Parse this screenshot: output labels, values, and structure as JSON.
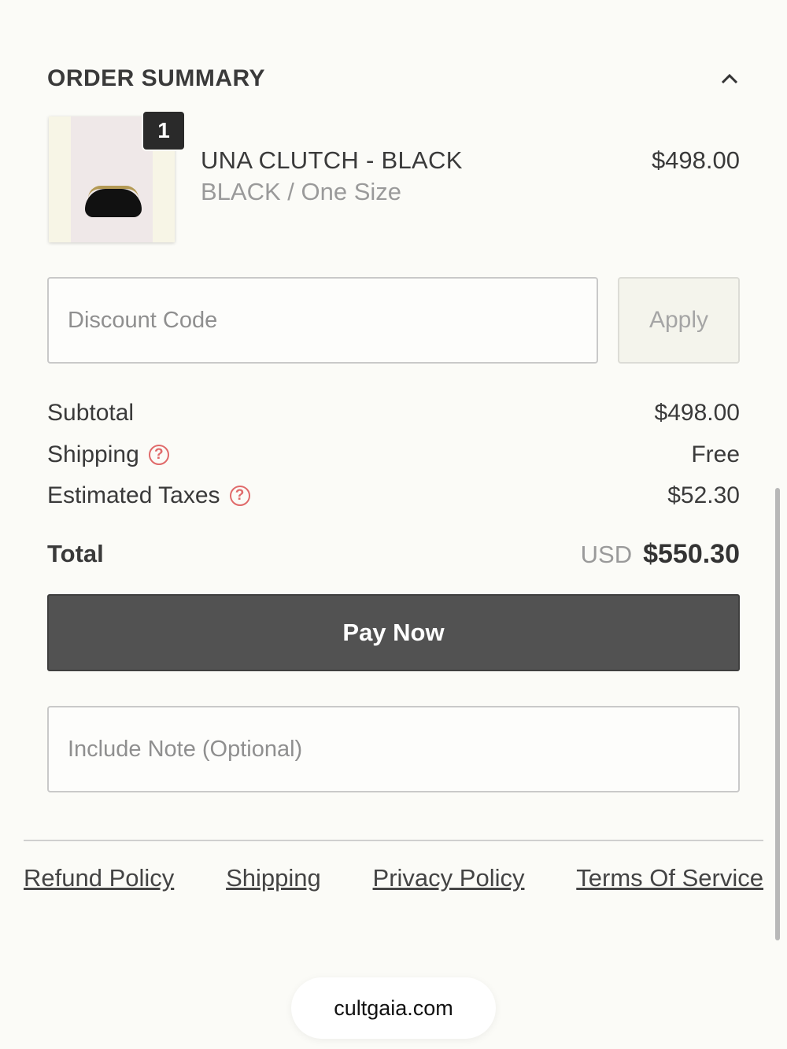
{
  "summary": {
    "title": "ORDER SUMMARY",
    "collapse_icon": "chevron-up-icon"
  },
  "item": {
    "quantity": "1",
    "name": "UNA CLUTCH - BLACK",
    "variant": "BLACK / One Size",
    "price": "$498.00"
  },
  "discount": {
    "placeholder": "Discount Code",
    "apply_label": "Apply"
  },
  "totals": {
    "subtotal_label": "Subtotal",
    "subtotal_value": "$498.00",
    "shipping_label": "Shipping",
    "shipping_value": "Free",
    "taxes_label": "Estimated Taxes",
    "taxes_value": "$52.30",
    "help_glyph": "?",
    "total_label": "Total",
    "currency": "USD",
    "total_value": "$550.30"
  },
  "pay_button": "Pay Now",
  "note": {
    "placeholder": "Include Note (Optional)"
  },
  "footer": {
    "links": [
      "Refund Policy",
      "Shipping",
      "Privacy Policy",
      "Terms Of Service"
    ]
  },
  "browser": {
    "url": "cultgaia.com"
  },
  "colors": {
    "background": "#fbfbf7",
    "pay_button": "#525252",
    "help_icon": "#e06a6a"
  }
}
